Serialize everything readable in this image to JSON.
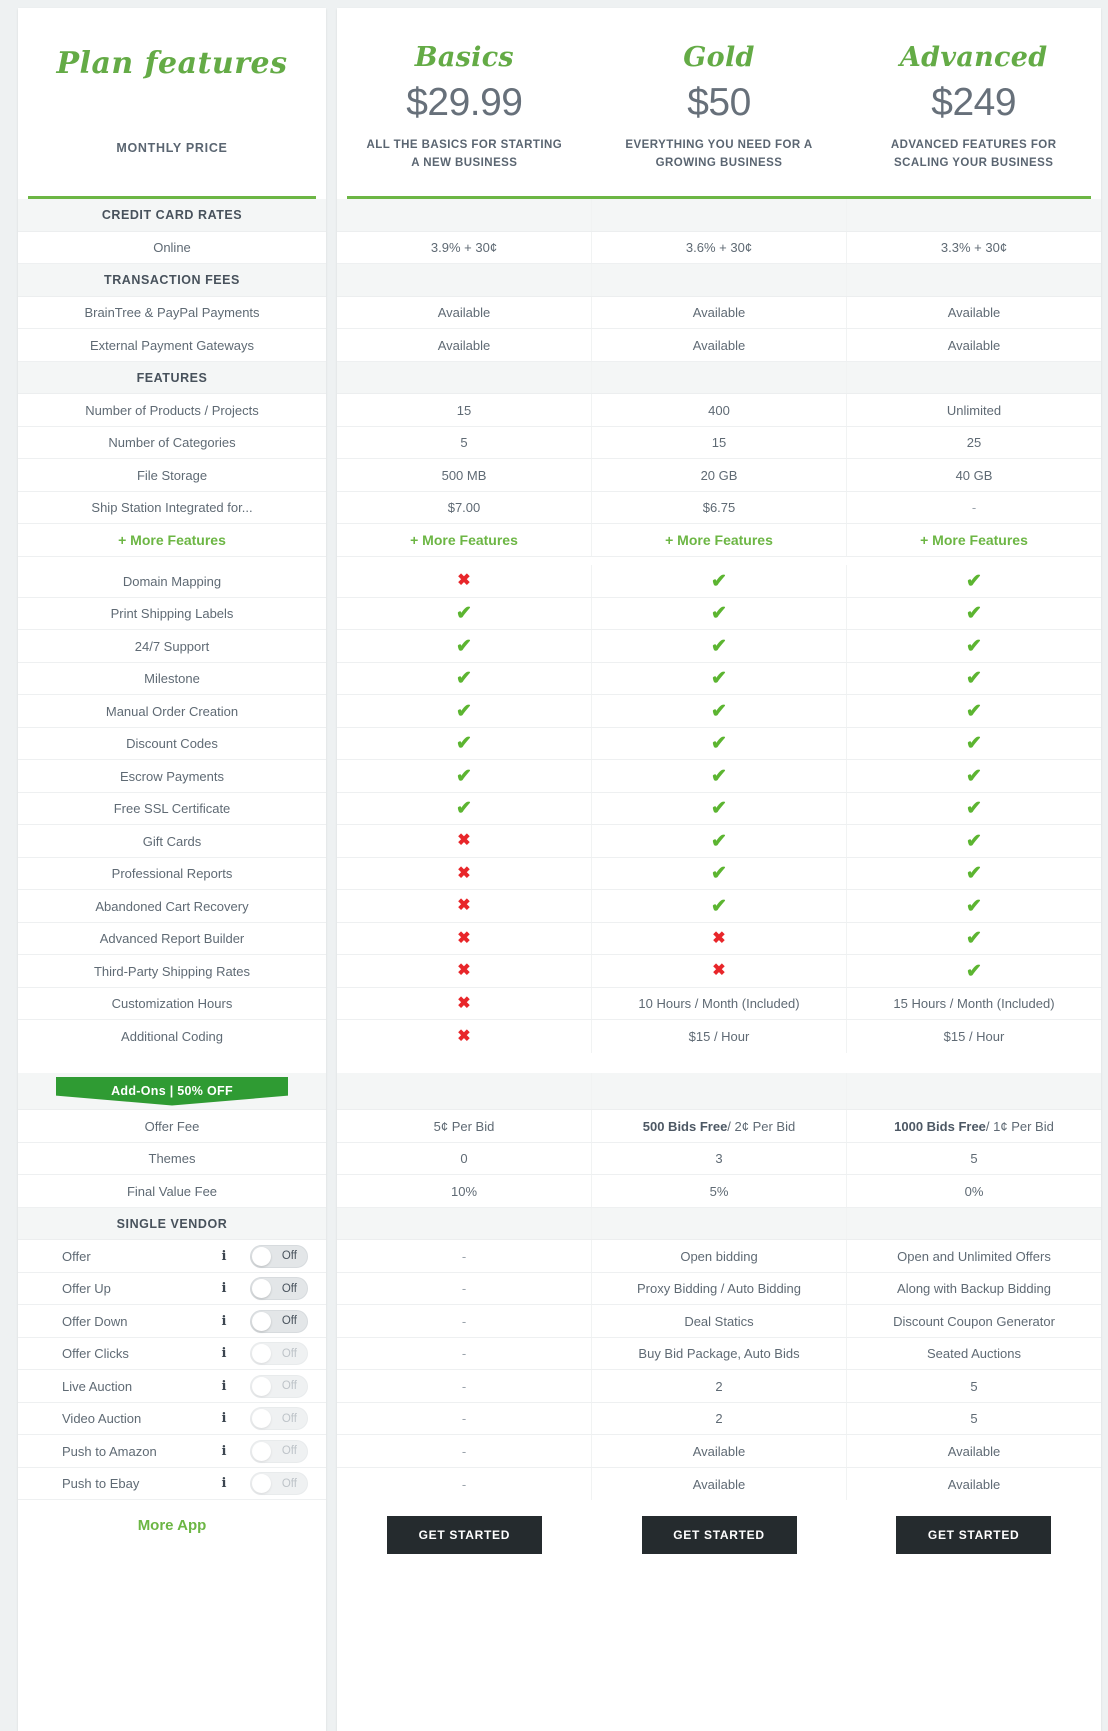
{
  "left": {
    "title": "Plan features",
    "monthly_price_label": "MONTHLY PRICE",
    "more_features_label": "+ More Features",
    "addon_ribbon_label": "Add-Ons | 50% OFF",
    "more_app_label": "More App",
    "sections": {
      "credit_card_rates": "CREDIT CARD RATES",
      "transaction_fees": "TRANSACTION FEES",
      "features": "FEATURES",
      "single_vendor": "SINGLE VENDOR"
    },
    "rows": {
      "online": "Online",
      "braintree": "BrainTree & PayPal Payments",
      "external_gateways": "External Payment Gateways",
      "products": "Number of Products / Projects",
      "categories": "Number of Categories",
      "file_storage": "File Storage",
      "ship_station": "Ship Station Integrated for...",
      "domain_mapping": "Domain Mapping",
      "print_labels": "Print Shipping Labels",
      "support": "24/7 Support",
      "milestone": "Milestone",
      "manual_order": "Manual Order Creation",
      "discount_codes": "Discount Codes",
      "escrow": "Escrow Payments",
      "ssl": "Free SSL Certificate",
      "gift_cards": "Gift Cards",
      "pro_reports": "Professional Reports",
      "abandoned_cart": "Abandoned Cart Recovery",
      "report_builder": "Advanced Report Builder",
      "third_party_ship": "Third-Party Shipping Rates",
      "customization_hours": "Customization Hours",
      "additional_coding": "Additional Coding",
      "offer_fee": "Offer Fee",
      "themes": "Themes",
      "final_value_fee": "Final Value Fee"
    },
    "toggles": [
      {
        "label": "Offer",
        "state": "Off",
        "faded": false
      },
      {
        "label": "Offer Up",
        "state": "Off",
        "faded": false
      },
      {
        "label": "Offer Down",
        "state": "Off",
        "faded": false
      },
      {
        "label": "Offer Clicks",
        "state": "Off",
        "faded": true
      },
      {
        "label": "Live Auction",
        "state": "Off",
        "faded": true
      },
      {
        "label": "Video Auction",
        "state": "Off",
        "faded": true
      },
      {
        "label": "Push to Amazon",
        "state": "Off",
        "faded": true
      },
      {
        "label": "Push to Ebay",
        "state": "Off",
        "faded": true
      }
    ]
  },
  "plans": [
    {
      "name": "Basics",
      "price": "$29.99",
      "desc_line1": "ALL THE BASICS FOR STARTING",
      "desc_line2": "A NEW BUSINESS",
      "cta": "GET STARTED"
    },
    {
      "name": "Gold",
      "price": "$50",
      "desc_line1": "EVERYTHING YOU NEED FOR A",
      "desc_line2": "GROWING BUSINESS",
      "cta": "GET STARTED"
    },
    {
      "name": "Advanced",
      "price": "$249",
      "desc_line1": "ADVANCED FEATURES FOR",
      "desc_line2": "SCALING YOUR BUSINESS",
      "cta": "GET STARTED"
    }
  ],
  "values": {
    "online": [
      "3.9% + 30¢",
      "3.6% + 30¢",
      "3.3% + 30¢"
    ],
    "braintree": [
      "Available",
      "Available",
      "Available"
    ],
    "external_gateways": [
      "Available",
      "Available",
      "Available"
    ],
    "products": [
      "15",
      "400",
      "Unlimited"
    ],
    "categories": [
      "5",
      "15",
      "25"
    ],
    "file_storage": [
      "500 MB",
      "20 GB",
      "40 GB"
    ],
    "ship_station": [
      "$7.00",
      "$6.75",
      "-"
    ],
    "more_features": [
      "+ More Features",
      "+ More Features",
      "+ More Features"
    ],
    "domain_mapping": [
      "cross",
      "tick",
      "tick"
    ],
    "print_labels": [
      "tick",
      "tick",
      "tick"
    ],
    "support": [
      "tick",
      "tick",
      "tick"
    ],
    "milestone": [
      "tick",
      "tick",
      "tick"
    ],
    "manual_order": [
      "tick",
      "tick",
      "tick"
    ],
    "discount_codes": [
      "tick",
      "tick",
      "tick"
    ],
    "escrow": [
      "tick",
      "tick",
      "tick"
    ],
    "ssl": [
      "tick",
      "tick",
      "tick"
    ],
    "gift_cards": [
      "cross",
      "tick",
      "tick"
    ],
    "pro_reports": [
      "cross",
      "tick",
      "tick"
    ],
    "abandoned_cart": [
      "cross",
      "tick",
      "tick"
    ],
    "report_builder": [
      "cross",
      "cross",
      "tick"
    ],
    "third_party_ship": [
      "cross",
      "cross",
      "tick"
    ],
    "customization_hours": [
      "cross",
      "10 Hours / Month (Included)",
      "15 Hours / Month (Included)"
    ],
    "additional_coding": [
      "cross",
      "$15 / Hour",
      "$15 / Hour"
    ],
    "offer_fee_bold": [
      "",
      "500 Bids Free",
      "1000 Bids Free"
    ],
    "offer_fee_rest": [
      "5¢ Per Bid",
      " / 2¢ Per Bid",
      " / 1¢ Per Bid"
    ],
    "themes": [
      "0",
      "3",
      "5"
    ],
    "final_value_fee": [
      "10%",
      "5%",
      "0%"
    ],
    "vendor_1": [
      "-",
      "Open bidding",
      "Open and Unlimited Offers"
    ],
    "vendor_2": [
      "-",
      "Proxy Bidding / Auto Bidding",
      "Along with Backup Bidding"
    ],
    "vendor_3": [
      "-",
      "Deal Statics",
      "Discount Coupon Generator"
    ],
    "vendor_4": [
      "-",
      "Buy Bid Package, Auto Bids",
      "Seated Auctions"
    ],
    "vendor_5": [
      "-",
      "2",
      "5"
    ],
    "vendor_6": [
      "-",
      "2",
      "5"
    ],
    "vendor_7": [
      "-",
      "Available",
      "Available"
    ],
    "vendor_8": [
      "-",
      "Available",
      "Available"
    ]
  }
}
